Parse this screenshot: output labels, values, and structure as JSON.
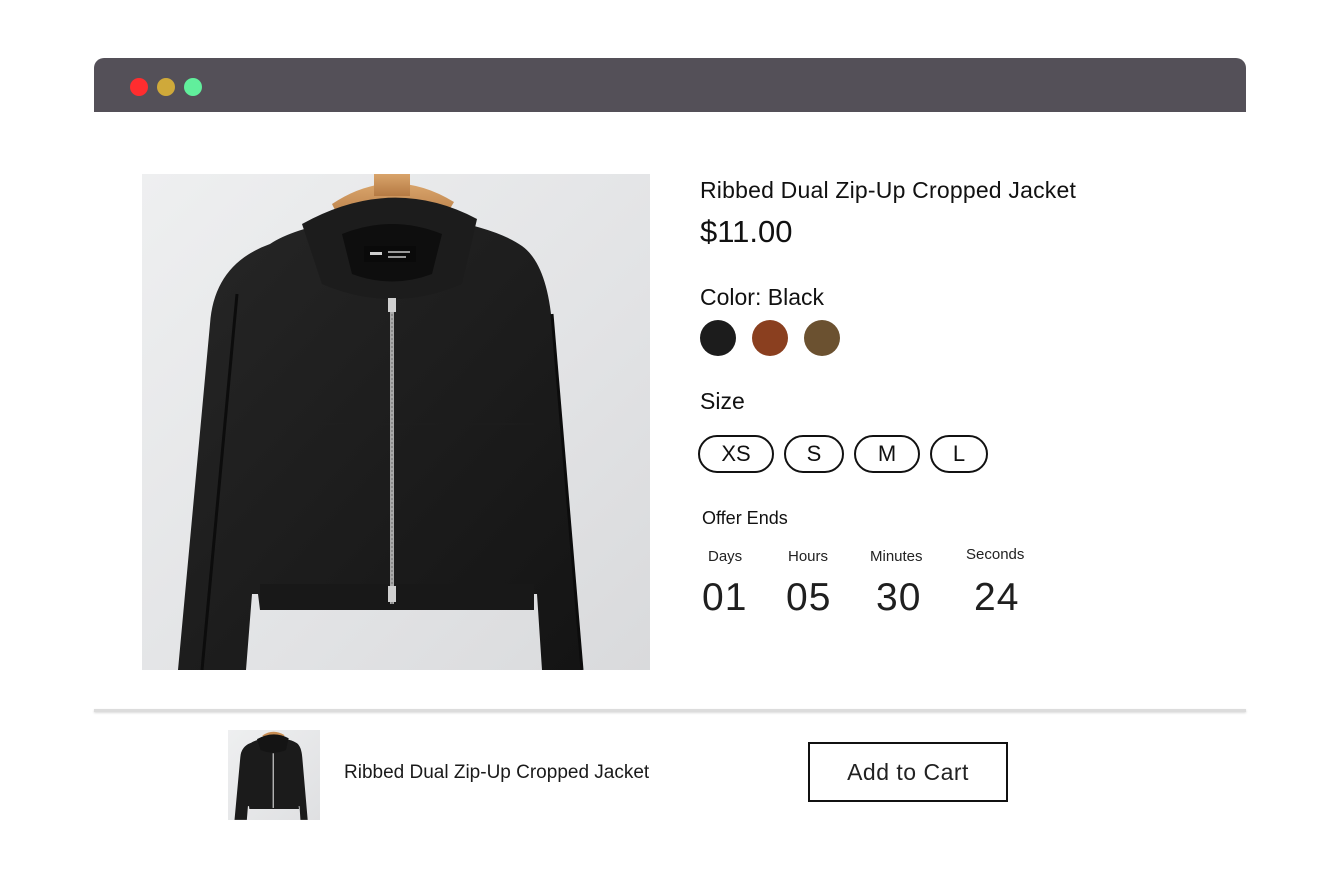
{
  "window": {
    "controls": [
      "close",
      "minimize",
      "maximize"
    ],
    "colors": {
      "bar": "#545058",
      "close": "#ff2d2f",
      "minimize": "#cfa93a",
      "maximize": "#61ef9c"
    }
  },
  "product": {
    "title": "Ribbed Dual Zip-Up Cropped Jacket",
    "price": "$11.00",
    "image_icon": "jacket-photo"
  },
  "color": {
    "label": "Color: Black",
    "swatches": [
      {
        "name": "Black",
        "hex": "#1c1c1c"
      },
      {
        "name": "Brown",
        "hex": "#8a3f1f"
      },
      {
        "name": "Olive",
        "hex": "#6b5130"
      }
    ]
  },
  "size": {
    "label": "Size",
    "options": [
      "XS",
      "S",
      "M",
      "L"
    ]
  },
  "offer": {
    "label": "Offer Ends",
    "units": [
      {
        "label": "Days",
        "value": "01"
      },
      {
        "label": "Hours",
        "value": "05"
      },
      {
        "label": "Minutes",
        "value": "30"
      },
      {
        "label": "Seconds",
        "value": "24"
      }
    ]
  },
  "sticky_bar": {
    "title": "Ribbed Dual Zip-Up Cropped Jacket",
    "cart_label": "Add to Cart"
  }
}
